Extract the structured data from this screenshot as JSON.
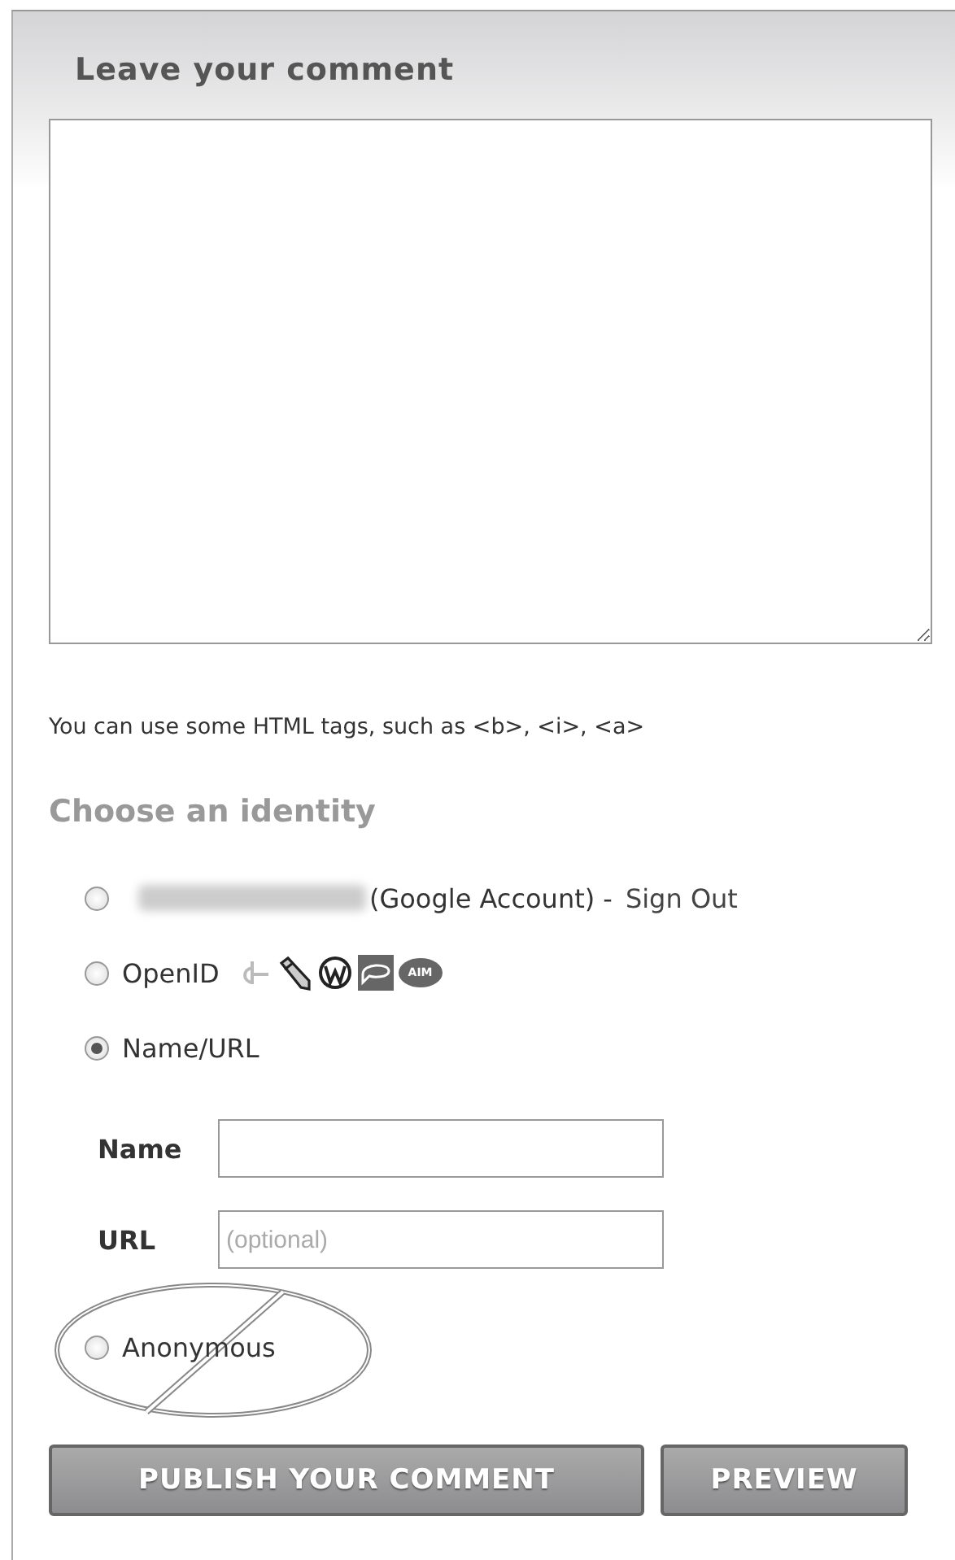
{
  "panel": {
    "title": "Leave your comment"
  },
  "help_text": "You can use some HTML tags, such as <b>, <i>, <a>",
  "identity": {
    "heading": "Choose an identity",
    "options": [
      {
        "kind": "account",
        "selected": false,
        "label": "(Google Account) -",
        "link": "Sign Out"
      },
      {
        "kind": "openid",
        "selected": false,
        "label": "OpenID",
        "badge": "AIM"
      },
      {
        "kind": "nameurl",
        "selected": true,
        "label": "Name/URL"
      },
      {
        "kind": "plain",
        "selected": false,
        "label": "Anonymous"
      }
    ]
  },
  "fields": [
    {
      "label": "Name"
    },
    {
      "label": "URL",
      "placeholder": "(optional)"
    }
  ],
  "buttons": [
    "PUBLISH YOUR COMMENT",
    "PREVIEW"
  ]
}
